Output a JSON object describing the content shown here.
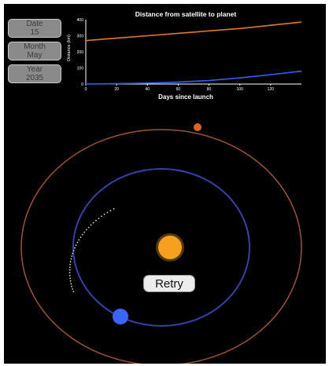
{
  "controls": {
    "date": {
      "label": "Date",
      "value": "15"
    },
    "month": {
      "label": "Month",
      "value": "May"
    },
    "year": {
      "label": "Year",
      "value": "2035"
    }
  },
  "graph": {
    "title": "Distance from satellite to planet",
    "xlabel": "Days since launch",
    "ylabel": "Distance (km)",
    "x_ticks": [
      "0",
      "20",
      "40",
      "60",
      "80",
      "100",
      "120"
    ],
    "y_ticks": [
      "400",
      "300",
      "200",
      "100",
      "0"
    ]
  },
  "chart_data": {
    "type": "line",
    "title": "Distance from satellite to planet",
    "xlabel": "Days since launch",
    "ylabel": "Distance (km)",
    "xlim": [
      0,
      140
    ],
    "ylim": [
      0,
      400
    ],
    "grid": false,
    "series": [
      {
        "color": "#e07a20",
        "x": [
          0,
          20,
          40,
          60,
          80,
          100,
          120,
          140
        ],
        "y": [
          270,
          285,
          300,
          315,
          330,
          345,
          365,
          385
        ]
      },
      {
        "color": "#3060ff",
        "x": [
          0,
          20,
          40,
          60,
          80,
          100,
          120,
          140
        ],
        "y": [
          0,
          2,
          6,
          12,
          22,
          38,
          58,
          80
        ]
      }
    ]
  },
  "retry_label": "Retry",
  "colors": {
    "background": "#000000",
    "sun": "#f5a020",
    "inner_orbit": "#3540a8",
    "outer_orbit": "#a0522d",
    "inner_planet": "#3a66ff",
    "outer_planet": "#e0641e",
    "trajectory": "#d8d8d8"
  }
}
